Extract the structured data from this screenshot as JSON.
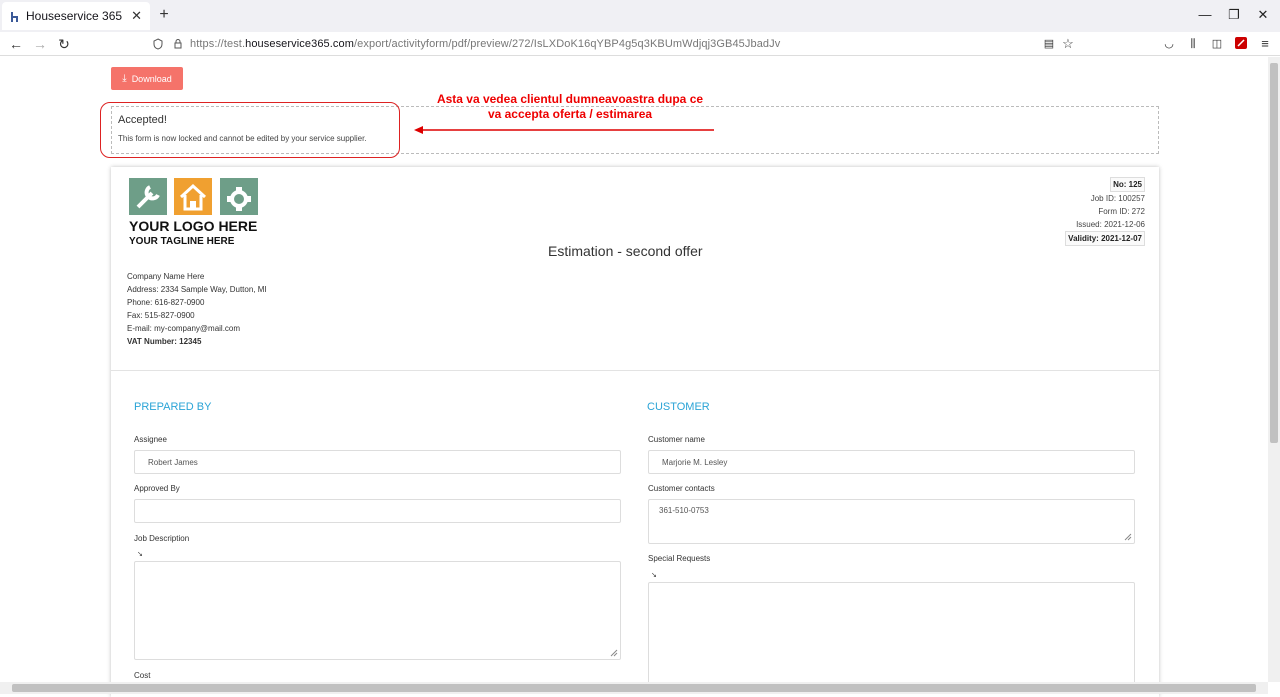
{
  "browser": {
    "tab_title": "Houseservice 365",
    "url_prefix": "https://test.",
    "url_domain": "houseservice365.com",
    "url_path": "/export/activityform/pdf/preview/272/IsLXDoK16qYBP4g5q3KBUmWdjqj3GB45JbadJv"
  },
  "page": {
    "download_label": "Download",
    "accepted_title": "Accepted!",
    "accepted_message": "This form is now locked and cannot be edited by your service supplier.",
    "annotation_line1": "Asta va vedea clientul dumneavoastra dupa ce",
    "annotation_line2": "va accepta oferta / estimarea"
  },
  "document": {
    "logo_main": "YOUR LOGO HERE",
    "logo_tagline": "YOUR TAGLINE HERE",
    "number": "No: 125",
    "job_id": "Job ID: 100257",
    "form_id": "Form ID: 272",
    "issued": "Issued: 2021-12-06",
    "validity": "Validity: 2021-12-07",
    "title": "Estimation - second offer",
    "company": {
      "name": "Company Name Here",
      "address": "Address: 2334 Sample Way, Dutton, MI",
      "phone": "Phone: 616-827-0900",
      "fax": "Fax: 515-827-0900",
      "email": "E-mail: my-company@mail.com",
      "vat": "VAT Number: 12345"
    },
    "prepared_by": {
      "heading": "PREPARED BY",
      "assignee_label": "Assignee",
      "assignee_value": "Robert James",
      "approved_label": "Approved By",
      "approved_value": "",
      "job_desc_label": "Job Description",
      "cost_label": "Cost"
    },
    "customer": {
      "heading": "CUSTOMER",
      "name_label": "Customer name",
      "name_value": "Marjorie M. Lesley",
      "contacts_label": "Customer contacts",
      "contacts_value": "361-510-0753",
      "special_label": "Special Requests"
    }
  },
  "colors": {
    "download_bg": "#f5736a",
    "section_heading": "#29a3d6",
    "annotation": "#ee0000"
  }
}
